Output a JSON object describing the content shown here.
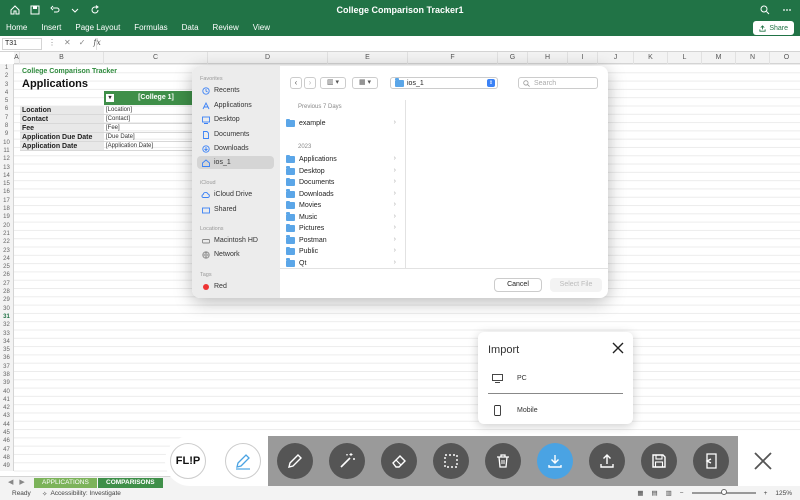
{
  "window": {
    "title": "College Comparison Tracker1"
  },
  "ribbon": {
    "tabs": [
      "Home",
      "Insert",
      "Page Layout",
      "Formulas",
      "Data",
      "Review",
      "View"
    ],
    "share_label": "Share"
  },
  "formula_bar": {
    "name_box": "T31",
    "fx_label": "fx",
    "value": ""
  },
  "grid": {
    "columns": [
      "A",
      "B",
      "C",
      "D",
      "E",
      "F",
      "G",
      "H",
      "I",
      "J",
      "K",
      "L",
      "M",
      "N",
      "O"
    ],
    "rows": [
      "1",
      "2",
      "3",
      "4",
      "5",
      "6",
      "7",
      "8",
      "9",
      "10",
      "11",
      "12",
      "13",
      "14",
      "15",
      "16",
      "17",
      "18",
      "19",
      "20",
      "21",
      "22",
      "23",
      "24",
      "25",
      "26",
      "27",
      "28",
      "29",
      "30",
      "31",
      "32",
      "33",
      "34",
      "35",
      "36",
      "37",
      "38",
      "39",
      "40",
      "41",
      "42",
      "43",
      "44",
      "45",
      "46",
      "47",
      "48",
      "49"
    ],
    "active_row": "31"
  },
  "sheet": {
    "title": "College Comparison Tracker",
    "subtitle": "Applications",
    "college_header": "[College 1]",
    "fields": [
      {
        "label": "Location",
        "value": "[Location]"
      },
      {
        "label": "Contact",
        "value": "[Contact]"
      },
      {
        "label": "Fee",
        "value": "[Fee]"
      },
      {
        "label": "Application Due Date",
        "value": "[Due Date]"
      },
      {
        "label": "Application Date",
        "value": "[Application Date]"
      }
    ]
  },
  "sheet_tabs": {
    "tabs": [
      "APPLICATIONS",
      "COMPARISONS"
    ],
    "active": "COMPARISONS"
  },
  "status": {
    "ready": "Ready",
    "accessibility": "Accessibility: Investigate",
    "zoom": "125%",
    "zoom_fraction": 0.5
  },
  "file_dialog": {
    "sidebar": {
      "favorites_label": "Favorites",
      "favorites": [
        "Recents",
        "Applications",
        "Desktop",
        "Documents",
        "Downloads",
        "ios_1"
      ],
      "icloud_label": "iCloud",
      "icloud": [
        "iCloud Drive",
        "Shared"
      ],
      "locations_label": "Locations",
      "locations": [
        "Macintosh HD",
        "Network"
      ],
      "tags_label": "Tags",
      "tags": [
        "Red"
      ],
      "selected": "ios_1"
    },
    "current_folder": "ios_1",
    "search_placeholder": "Search",
    "sections": [
      {
        "label": "Previous 7 Days",
        "items": [
          "example"
        ]
      },
      {
        "label": "2023",
        "items": [
          "Applications",
          "Desktop",
          "Documents",
          "Downloads",
          "Movies",
          "Music",
          "Pictures",
          "Postman",
          "Public",
          "Qt"
        ]
      }
    ],
    "cancel_label": "Cancel",
    "select_label": "Select File"
  },
  "import_panel": {
    "title": "Import",
    "options": [
      "PC",
      "Mobile"
    ]
  },
  "toolbar": {
    "logo_text": "FL!P",
    "tools": [
      "pen-icon",
      "magic-wand-icon",
      "eraser-icon",
      "select-box-icon",
      "trash-icon",
      "download-icon",
      "upload-icon",
      "save-icon",
      "exit-icon"
    ],
    "active_tool": "download-icon",
    "accent_color": "#4aa3e3",
    "brand_color": "#217346"
  }
}
